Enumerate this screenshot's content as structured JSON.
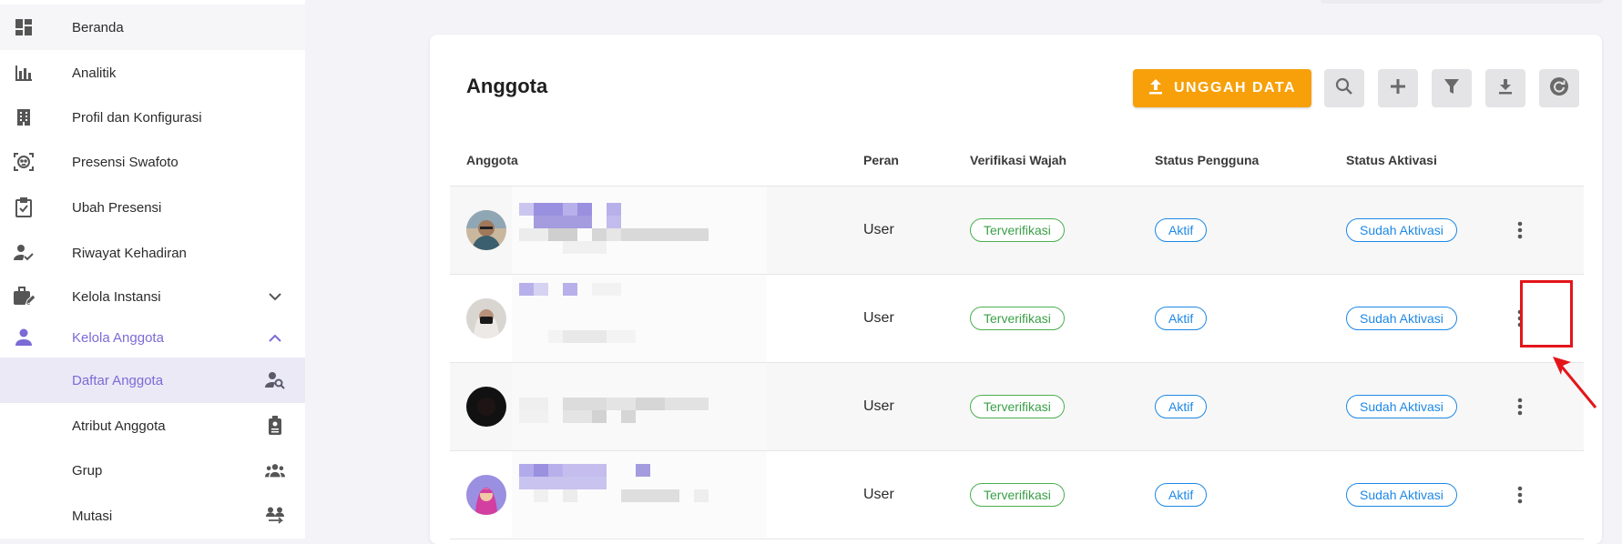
{
  "sidebar": {
    "items": [
      {
        "label": "Beranda",
        "icon": "dashboard-icon"
      },
      {
        "label": "Analitik",
        "icon": "bar-chart-icon"
      },
      {
        "label": "Profil dan Konfigurasi",
        "icon": "building-icon"
      },
      {
        "label": "Presensi Swafoto",
        "icon": "face-scan-icon"
      },
      {
        "label": "Ubah Presensi",
        "icon": "clipboard-check-icon"
      },
      {
        "label": "Riwayat Kehadiran",
        "icon": "person-check-icon"
      },
      {
        "label": "Kelola Instansi",
        "icon": "briefcase-edit-icon"
      },
      {
        "label": "Kelola Anggota",
        "icon": "person-icon"
      },
      {
        "label": "Daftar Anggota",
        "icon": "person-search-icon"
      },
      {
        "label": "Atribut Anggota",
        "icon": "badge-icon"
      },
      {
        "label": "Grup",
        "icon": "group-icon"
      },
      {
        "label": "Mutasi",
        "icon": "transfer-people-icon"
      }
    ]
  },
  "main": {
    "title": "Anggota",
    "upload_label": "UNGGAH DATA",
    "tools": [
      "search-icon",
      "add-icon",
      "filter-icon",
      "download-icon",
      "refresh-icon"
    ],
    "columns": [
      "Anggota",
      "Peran",
      "Verifikasi Wajah",
      "Status Pengguna",
      "Status Aktivasi"
    ],
    "rows": [
      {
        "role": "User",
        "face": "Terverifikasi",
        "user_status": "Aktif",
        "activation": "Sudah Aktivasi"
      },
      {
        "role": "User",
        "face": "Terverifikasi",
        "user_status": "Aktif",
        "activation": "Sudah Aktivasi"
      },
      {
        "role": "User",
        "face": "Terverifikasi",
        "user_status": "Aktif",
        "activation": "Sudah Aktivasi"
      },
      {
        "role": "User",
        "face": "Terverifikasi",
        "user_status": "Aktif",
        "activation": "Sudah Aktivasi"
      }
    ]
  },
  "colors": {
    "accent": "#7b6bd6",
    "upload": "#f7a00a",
    "verified": "#3aa047",
    "status_blue": "#1e88e5",
    "annotation": "#e3151a"
  }
}
